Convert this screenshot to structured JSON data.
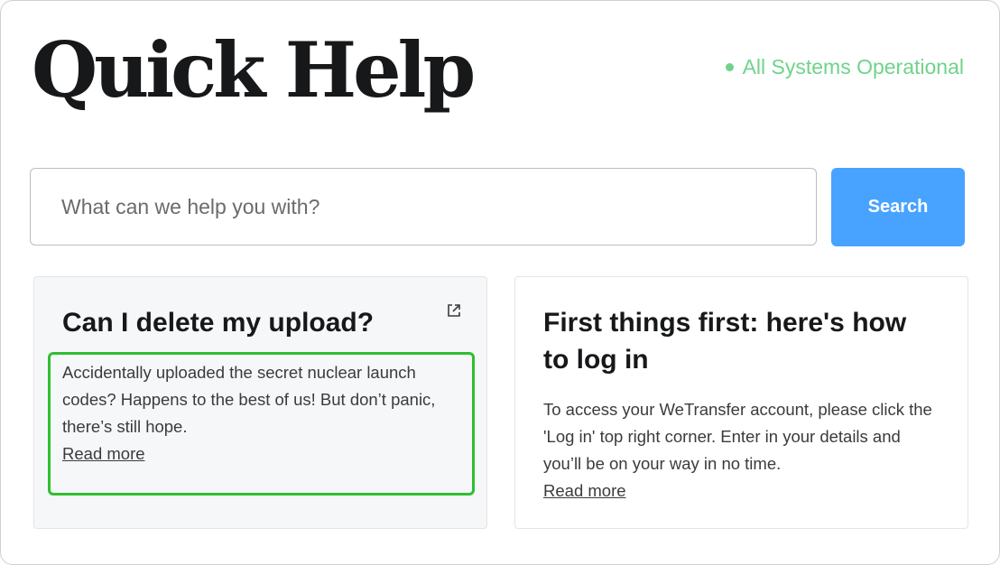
{
  "header": {
    "title": "Quick Help",
    "status": {
      "text": "All Systems Operational",
      "color": "#6fd38b"
    }
  },
  "search": {
    "placeholder": "What can we help you with?",
    "value": "",
    "button_label": "Search",
    "button_color": "#47a3ff"
  },
  "cards": [
    {
      "title": "Can I delete my upload?",
      "body": "Accidentally uploaded the secret nuclear launch codes? Happens to the best of us! But don’t panic, there’s still hope.",
      "link_label": "Read more",
      "icon": "external-link-icon",
      "highlight_color": "#2fbf2f"
    },
    {
      "title": "First things first: here's how to log in",
      "body": "To access your WeTransfer account, please click the 'Log in' top right corner. Enter in your details and you’ll be on your way in no time.",
      "link_label": "Read more"
    }
  ]
}
